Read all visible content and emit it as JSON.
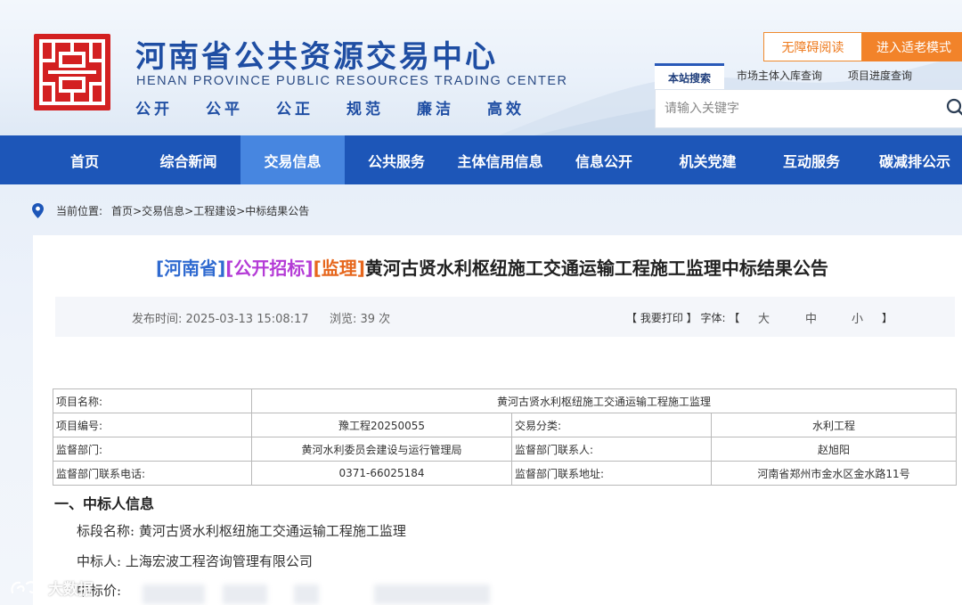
{
  "header": {
    "site_name_cn": "河南省公共资源交易中心",
    "site_name_en": "HENAN PROVINCE PUBLIC RESOURCES TRADING CENTER",
    "slogans": [
      "公开",
      "公平",
      "公正",
      "规范",
      "廉洁",
      "高效"
    ],
    "accessibility_label": "无障碍阅读",
    "elder_mode_label": "进入适老模式",
    "search_tab_label": "本站搜索",
    "quick_links": [
      "市场主体入库查询",
      "项目进度查询"
    ],
    "search_placeholder": "请输入关键字",
    "logo_color": "#d32021",
    "brand_color": "#1f4ea3"
  },
  "nav": {
    "items": [
      "首页",
      "综合新闻",
      "交易信息",
      "公共服务",
      "主体信用信息",
      "信息公开",
      "机关党建",
      "互动服务",
      "碳减排公示"
    ],
    "active_index": 2,
    "bg_color": "#1d56b8",
    "active_color": "#4786e0"
  },
  "breadcrumb": {
    "label": "当前位置:",
    "items": [
      "首页",
      "交易信息",
      "工程建设",
      "中标结果公告"
    ],
    "separator": ">"
  },
  "article": {
    "tag_region": "[河南省]",
    "tag_method": "[公开招标]",
    "tag_type": "[监理]",
    "title_text": "黄河古贤水利枢纽施工交通运输工程施工监理中标结果公告",
    "publish_time": "发布时间: 2025-03-13 15:08:17",
    "views": "浏览: 39 次",
    "print_label": "【 我要打印 】 字体: 【",
    "font_large": "大",
    "font_medium": "中",
    "font_small": "小",
    "font_close": "】"
  },
  "info_table": {
    "project_name_label": "项目名称:",
    "project_name": "黄河古贤水利枢纽施工交通运输工程施工监理",
    "project_no_label": "项目编号:",
    "project_no": "豫工程20250055",
    "category_label": "交易分类:",
    "category": "水利工程",
    "supervisor_label": "监督部门:",
    "supervisor": "黄河水利委员会建设与运行管理局",
    "contact_label": "监督部门联系人:",
    "contact": "赵旭阳",
    "phone_label": "监督部门联系电话:",
    "phone": "0371-66025184",
    "address_label": "监督部门联系地址:",
    "address": "河南省郑州市金水区金水路11号"
  },
  "winner_section": {
    "heading": "一、中标人信息",
    "lot_name": "标段名称: 黄河古贤水利枢纽施工交通运输工程施工监理",
    "winner": "中标人: 上海宏波工程咨询管理有限公司",
    "bid_price_label": "中标价:"
  },
  "watermark": {
    "text": "大数据"
  }
}
